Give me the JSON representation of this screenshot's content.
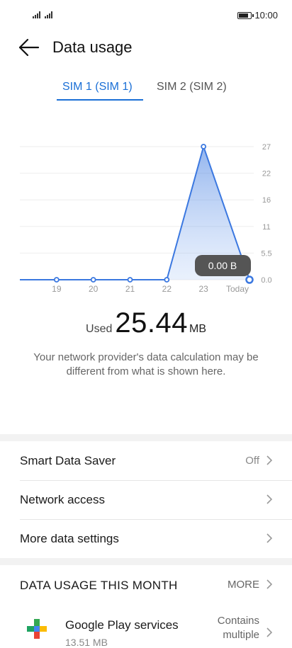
{
  "status": {
    "time": "10:00",
    "battery_level": 0.85
  },
  "header": {
    "title": "Data usage",
    "back_icon": "arrow-left-icon"
  },
  "tabs": [
    {
      "label": "SIM 1 (SIM 1)",
      "active": true
    },
    {
      "label": "SIM 2 (SIM 2)",
      "active": false
    }
  ],
  "chart_data": {
    "type": "area",
    "x": [
      "",
      "19",
      "20",
      "21",
      "22",
      "23",
      "Today"
    ],
    "values": [
      0,
      0,
      0,
      0,
      0,
      27,
      0
    ],
    "y_ticks": [
      "27",
      "22",
      "16",
      "11",
      "5.5",
      "0.0"
    ],
    "ylim": [
      0,
      27
    ],
    "tooltip": "0.00 B",
    "accent": "#3b78e0",
    "fill": "#a9c6f5"
  },
  "summary": {
    "used_label": "Used",
    "used_value": "25.44",
    "used_unit": "MB",
    "note": "Your network provider's data calculation may be different from what is shown here."
  },
  "settings": [
    {
      "label": "Smart Data Saver",
      "value": "Off"
    },
    {
      "label": "Network access",
      "value": ""
    },
    {
      "label": "More data settings",
      "value": ""
    }
  ],
  "month": {
    "title": "DATA USAGE THIS MONTH",
    "more_label": "MORE",
    "apps": [
      {
        "name": "Google Play services",
        "size": "13.51 MB",
        "note_line1": "Contains",
        "note_line2": "multiple",
        "icon": "google-play-services-icon"
      }
    ]
  }
}
